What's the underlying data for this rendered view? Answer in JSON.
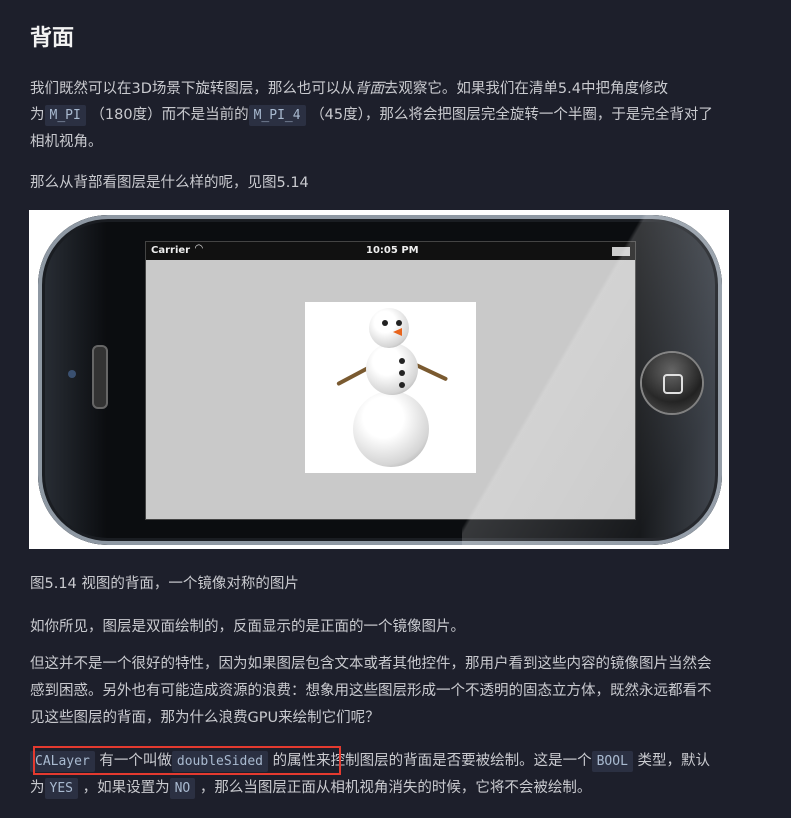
{
  "title": "背面",
  "para1": {
    "l1_a": "我们既然可以在3D场景下旋转图层，那么也可以从",
    "l1_em": "背面",
    "l1_b": "去观察它。如果我们在清单5.4中把角度修改",
    "l2_a": "为",
    "code1": "M_PI",
    "l2_b": "（180度）而不是当前的",
    "code2": "M_PI_4",
    "l2_c": "（45度），那么将会把图层完全旋转一个半圈，于是完全背对了",
    "l3": "相机视角。"
  },
  "para2": "那么从背部看图层是什么样的呢，见图5.14",
  "figure": {
    "carrier": "Carrier",
    "time": "10:05 PM"
  },
  "caption": "图5.14 视图的背面，一个镜像对称的图片",
  "para3": "如你所见，图层是双面绘制的，反面显示的是正面的一个镜像图片。",
  "para4": {
    "l1": "但这并不是一个很好的特性，因为如果图层包含文本或者其他控件，那用户看到这些内容的镜像图片当然会",
    "l2": "感到困惑。另外也有可能造成资源的浪费：想象用这些图层形成一个不透明的固态立方体，既然永远都看不",
    "l3": "见这些图层的背面，那为什么浪费GPU来绘制它们呢？"
  },
  "para5": {
    "code1": "CALayer",
    "a": "有一个叫做",
    "code2": "doubleSided",
    "b": "的属性来控制图层的背面是否要被绘制。这是一个",
    "code3": "BOOL",
    "c": "类型，默认",
    "d": "为",
    "code4": "YES",
    "e": "，如果设置为",
    "code5": "NO",
    "f": "，那么当图层正面从相机视角消失的时候，它将不会被绘制。"
  }
}
